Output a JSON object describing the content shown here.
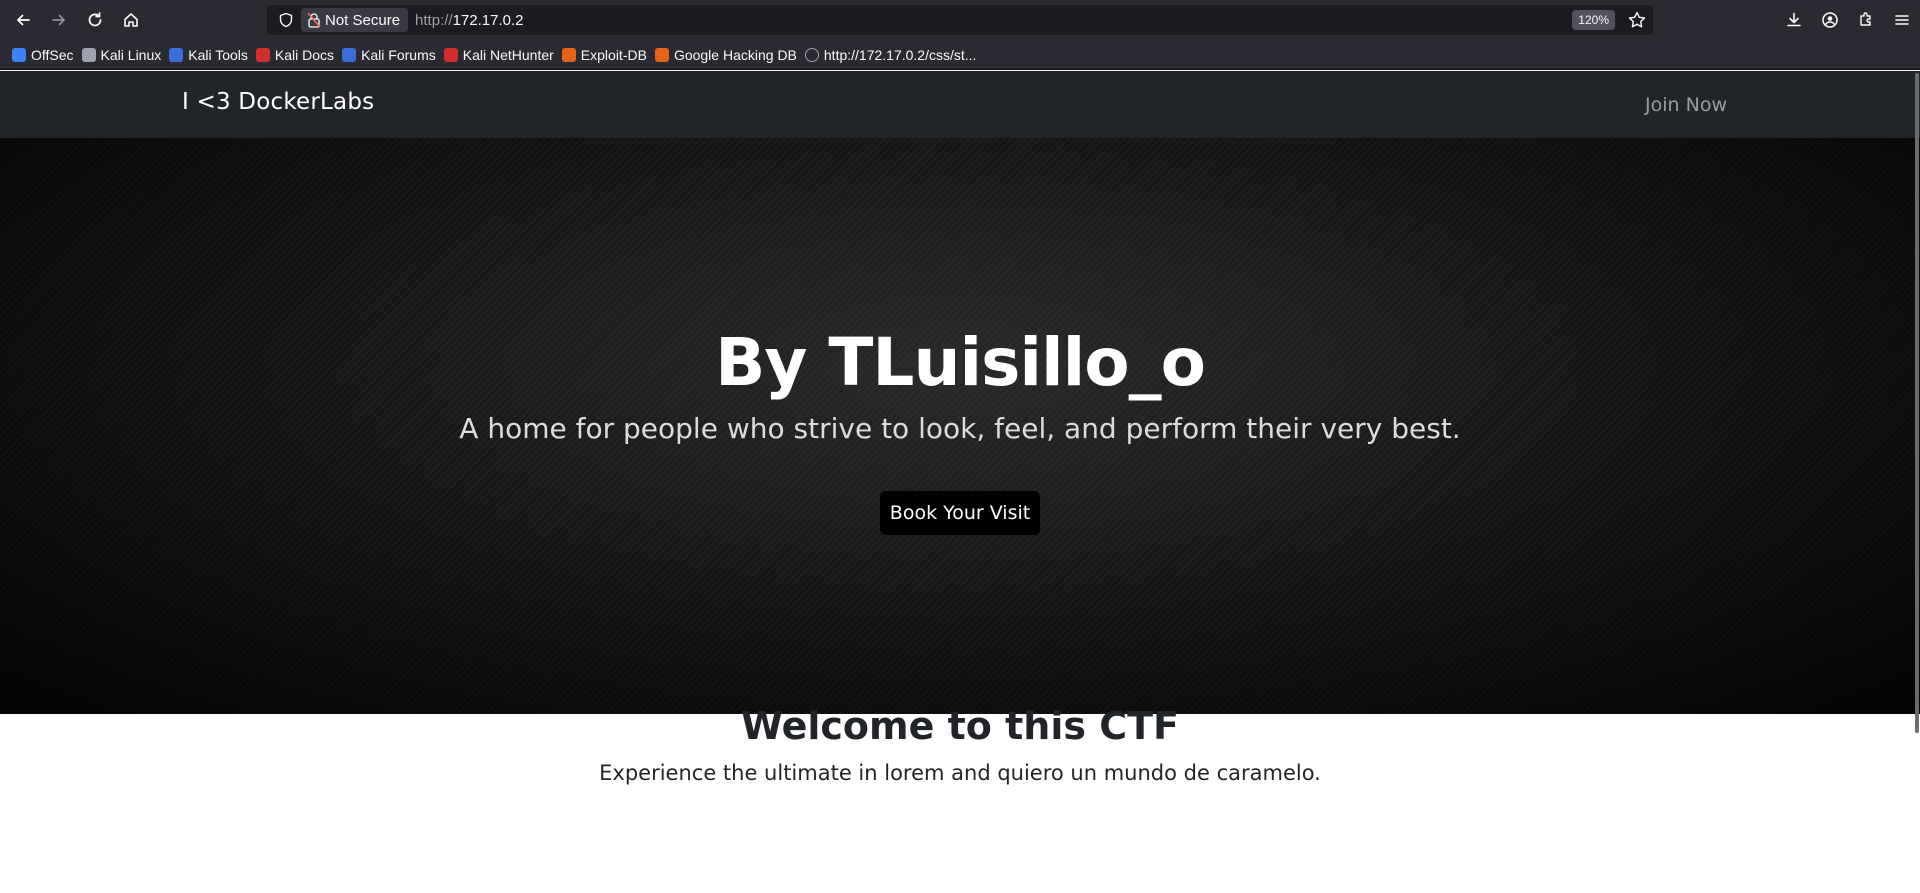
{
  "browser": {
    "security_label": "Not Secure",
    "url_scheme": "http://",
    "url_host": "172.17.0.2",
    "zoom": "120%",
    "icons": {
      "back": "arrow-left-icon",
      "forward": "arrow-right-icon",
      "reload": "reload-icon",
      "home": "home-icon",
      "shield": "shield-icon",
      "lock": "lock-insecure-icon",
      "bookmark": "star-icon",
      "downloads": "download-icon",
      "account": "account-icon",
      "extensions": "puzzle-icon",
      "menu": "hamburger-menu-icon"
    }
  },
  "bookmarks": [
    {
      "label": "OffSec",
      "color": "#3b82f6"
    },
    {
      "label": "Kali Linux",
      "color": "#9ca3af"
    },
    {
      "label": "Kali Tools",
      "color": "#3b6fd8"
    },
    {
      "label": "Kali Docs",
      "color": "#d12d2d"
    },
    {
      "label": "Kali Forums",
      "color": "#3b6fd8"
    },
    {
      "label": "Kali NetHunter",
      "color": "#d12d2d"
    },
    {
      "label": "Exploit-DB",
      "color": "#e8631a"
    },
    {
      "label": "Google Hacking DB",
      "color": "#e8631a"
    },
    {
      "label": "http://172.17.0.2/css/st...",
      "color": "#9ca3af"
    }
  ],
  "site": {
    "brand": "I <3 DockerLabs",
    "nav_link": "Join Now",
    "hero": {
      "title": "By TLuisillo_o",
      "subtitle": "A home for people who strive to look, feel, and perform their very best.",
      "button": "Book Your Visit"
    },
    "welcome": {
      "title": "Welcome to this CTF",
      "subtitle": "Experience the ultimate in lorem and quiero un mundo de caramelo."
    }
  }
}
